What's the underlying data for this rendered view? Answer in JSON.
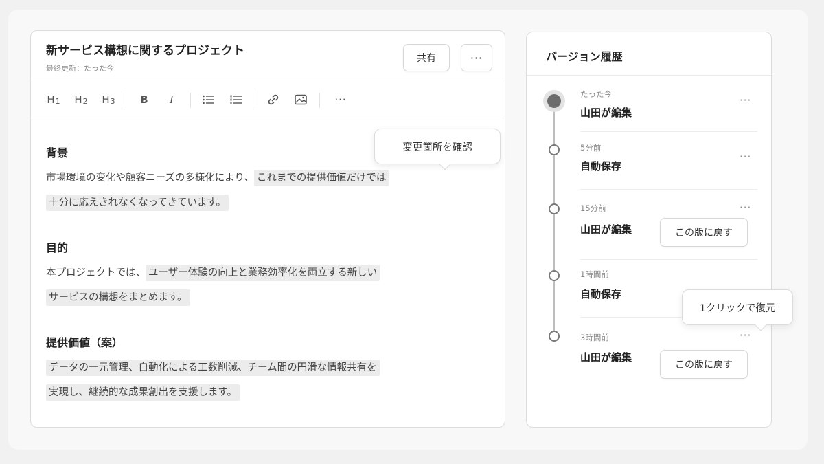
{
  "editor": {
    "title": "新サービス構想に関するプロジェクト",
    "last_updated": "最終更新：たった今",
    "share_label": "共有",
    "more_label": "···",
    "toolbar": {
      "h1": "H",
      "h1_sub": "1",
      "h2": "H",
      "h2_sub": "2",
      "h3": "H",
      "h3_sub": "3",
      "bold": "B",
      "italic": "I",
      "more": "···"
    },
    "sections": [
      {
        "heading": "背景",
        "lines": [
          {
            "plain": "市場環境の変化や顧客ニーズの多様化により、",
            "highlight": "これまでの提供価値だけでは"
          },
          {
            "plain": "",
            "highlight": "十分に応えきれなくなってきています。"
          }
        ]
      },
      {
        "heading": "目的",
        "lines": [
          {
            "plain": "本プロジェクトでは、",
            "highlight": "ユーザー体験の向上と業務効率化を両立する新しい"
          },
          {
            "plain": "",
            "highlight": "サービスの構想をまとめます。"
          }
        ]
      },
      {
        "heading": "提供価値（案）",
        "lines": [
          {
            "plain": "",
            "highlight": "データの一元管理、自動化による工数削減、チーム間の円滑な情報共有を"
          },
          {
            "plain": "",
            "highlight": "実現し、継続的な成果創出を支援します。"
          }
        ]
      }
    ],
    "tooltip_changes": "変更箇所を確認"
  },
  "history": {
    "title": "バージョン履歴",
    "versions": [
      {
        "time": "たった今",
        "label": "山田が編集",
        "current": true
      },
      {
        "time": "5分前",
        "label": "自動保存"
      },
      {
        "time": "15分前",
        "label": "山田が編集",
        "restore": "この版に戻す"
      },
      {
        "time": "1時間前",
        "label": "自動保存"
      },
      {
        "time": "3時間前",
        "label": "山田が編集",
        "restore": "この版に戻す"
      }
    ],
    "more_label": "···",
    "tooltip_restore": "1クリックで復元"
  },
  "icons": {
    "bullet_list": "bullet-list-icon",
    "numbered_list": "numbered-list-icon",
    "link": "link-icon",
    "image": "image-icon",
    "more": "more-icon"
  }
}
